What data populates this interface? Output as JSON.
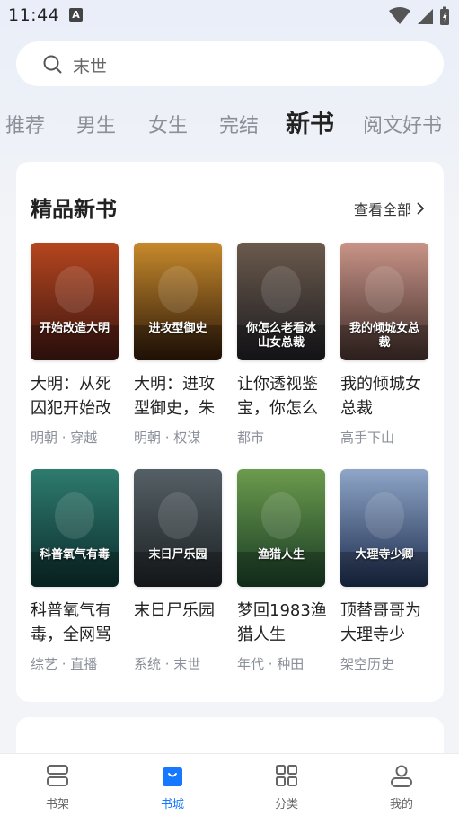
{
  "status_bar": {
    "time": "11:44",
    "notif_glyph": "A"
  },
  "search": {
    "placeholder": "末世"
  },
  "tabs": [
    {
      "label": "推荐"
    },
    {
      "label": "男生"
    },
    {
      "label": "女生"
    },
    {
      "label": "完结"
    },
    {
      "label": "新书",
      "active": true
    },
    {
      "label": "阅文好书"
    }
  ],
  "section": {
    "title": "精品新书",
    "view_all": "查看全部"
  },
  "books": [
    {
      "title": "大明：从死囚犯开始改",
      "tags": "明朝 · 穿越",
      "cover_text": "开始改造大明",
      "cover_colors": [
        "#3a1410",
        "#b5461e"
      ]
    },
    {
      "title": "大明：进攻型御史，朱",
      "tags": "明朝 · 权谋",
      "cover_text": "进攻型御史",
      "cover_colors": [
        "#2a1608",
        "#c78a2c"
      ]
    },
    {
      "title": "让你透视鉴宝，你怎么",
      "tags": "都市",
      "cover_text": "你怎么老看冰山女总裁",
      "cover_colors": [
        "#1a1a1f",
        "#6b5a4c"
      ]
    },
    {
      "title": "我的倾城女总裁",
      "tags": "高手下山",
      "cover_text": "我的倾城女总裁",
      "cover_colors": [
        "#3b2a26",
        "#c99488"
      ]
    },
    {
      "title": "科普氧气有毒，全网骂",
      "tags": "综艺 · 直播",
      "cover_text": "科普氧气有毒",
      "cover_colors": [
        "#0b2b2b",
        "#2e7b6e"
      ]
    },
    {
      "title": "末日尸乐园",
      "tags": "系统 · 末世",
      "cover_text": "末日尸乐园",
      "cover_colors": [
        "#1b1f22",
        "#556066"
      ]
    },
    {
      "title": "梦回1983渔猎人生",
      "tags": "年代 · 种田",
      "cover_text": "渔猎人生",
      "cover_colors": [
        "#173a24",
        "#6c9b4d"
      ]
    },
    {
      "title": "顶替哥哥为大理寺少",
      "tags": "架空历史",
      "cover_text": "大理寺少卿",
      "cover_colors": [
        "#1a2a4a",
        "#8fa6c9"
      ]
    }
  ],
  "bottom_nav": [
    {
      "label": "书架",
      "icon": "bookshelf-icon"
    },
    {
      "label": "书城",
      "icon": "bookstore-icon",
      "active": true
    },
    {
      "label": "分类",
      "icon": "category-icon"
    },
    {
      "label": "我的",
      "icon": "profile-icon"
    }
  ],
  "colors": {
    "accent": "#1677ff",
    "muted": "#8a8f99"
  }
}
